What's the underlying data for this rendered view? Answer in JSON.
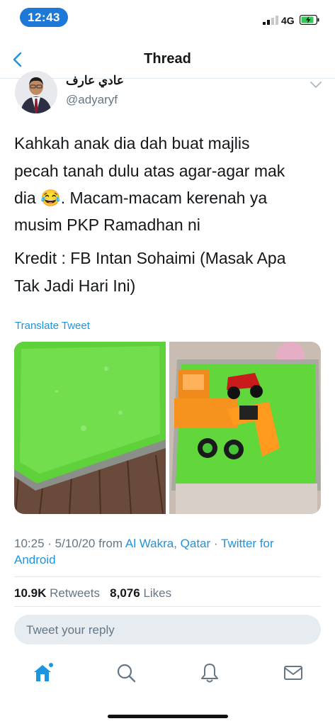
{
  "status_bar": {
    "time": "12:43",
    "network": "4G"
  },
  "nav": {
    "title": "Thread"
  },
  "author": {
    "name": "عادي عارف",
    "handle": "@adyaryf"
  },
  "tweet": {
    "lines": [
      "Kahkah anak dia dah buat majlis",
      "pecah tanah dulu atas agar-agar mak",
      "dia 😂. Macam-macam kerenah ya",
      "musim PKP Ramadhan ni"
    ],
    "credit_lines": [
      "Kredit : FB Intan Sohaimi (Masak Apa",
      "Tak Jadi Hari Ini)"
    ],
    "translate": "Translate Tweet"
  },
  "meta": {
    "datetime": "10:25 · 5/10/20 from ",
    "location": "Al Wakra, Qatar",
    "separator": " · ",
    "client": "Twitter for Android"
  },
  "stats": {
    "retweets_count": "10.9K",
    "retweets_label": "Retweets",
    "likes_count": "8,076",
    "likes_label": "Likes"
  },
  "reply": {
    "placeholder": "Tweet your reply"
  },
  "tabbar": {
    "items": [
      "home-icon",
      "search-icon",
      "notifications-icon",
      "messages-icon"
    ]
  },
  "colors": {
    "accent": "#1b95e0",
    "time_pill": "#1d78d8",
    "jelly": "#6fd64a"
  }
}
